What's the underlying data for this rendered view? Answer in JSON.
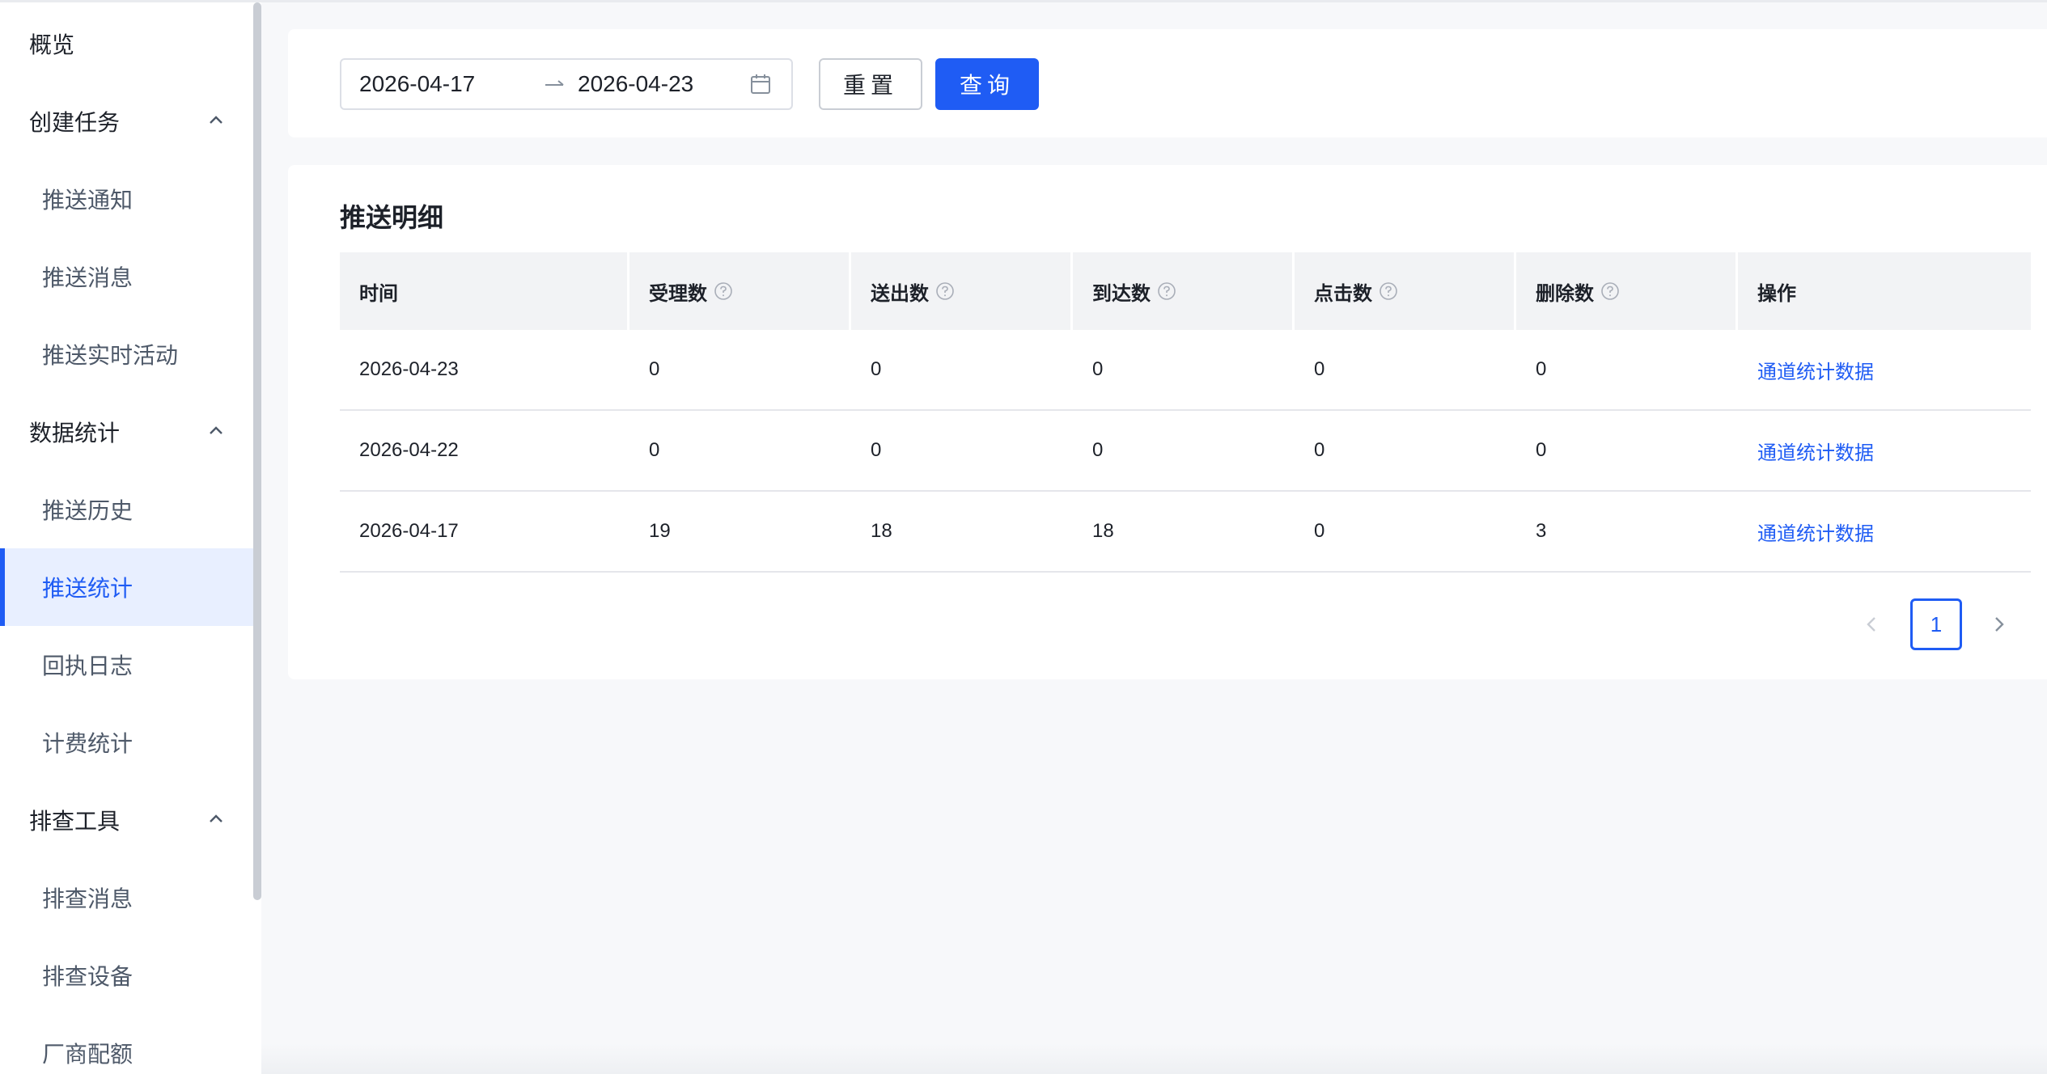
{
  "sidebar": {
    "items": [
      {
        "label": "概览",
        "type": "top",
        "expandable": false
      },
      {
        "label": "创建任务",
        "type": "group",
        "expandable": true
      },
      {
        "label": "推送通知",
        "type": "sub"
      },
      {
        "label": "推送消息",
        "type": "sub"
      },
      {
        "label": "推送实时活动",
        "type": "sub"
      },
      {
        "label": "数据统计",
        "type": "group",
        "expandable": true
      },
      {
        "label": "推送历史",
        "type": "sub"
      },
      {
        "label": "推送统计",
        "type": "sub",
        "active": true
      },
      {
        "label": "回执日志",
        "type": "sub"
      },
      {
        "label": "计费统计",
        "type": "sub"
      },
      {
        "label": "排查工具",
        "type": "group",
        "expandable": true
      },
      {
        "label": "排查消息",
        "type": "sub"
      },
      {
        "label": "排查设备",
        "type": "sub"
      },
      {
        "label": "厂商配额",
        "type": "sub"
      }
    ]
  },
  "filter": {
    "start_date": "2026-04-17",
    "end_date": "2026-04-23",
    "reset_label": "重置",
    "query_label": "查询"
  },
  "table": {
    "title": "推送明细",
    "columns": [
      "时间",
      "受理数",
      "送出数",
      "到达数",
      "点击数",
      "删除数",
      "操作"
    ],
    "help_columns": [
      1,
      2,
      3,
      4,
      5
    ],
    "rows": [
      {
        "date": "2026-04-23",
        "accepted": "0",
        "sent": "0",
        "arrived": "0",
        "clicked": "0",
        "deleted": "0",
        "action": "通道统计数据"
      },
      {
        "date": "2026-04-22",
        "accepted": "0",
        "sent": "0",
        "arrived": "0",
        "clicked": "0",
        "deleted": "0",
        "action": "通道统计数据"
      },
      {
        "date": "2026-04-17",
        "accepted": "19",
        "sent": "18",
        "arrived": "18",
        "clicked": "0",
        "deleted": "3",
        "action": "通道统计数据"
      }
    ]
  },
  "pagination": {
    "current_page": "1"
  },
  "colors": {
    "accent": "#1f5cf4",
    "active_bg": "#e8efff",
    "page_bg": "#f7f8fa"
  }
}
